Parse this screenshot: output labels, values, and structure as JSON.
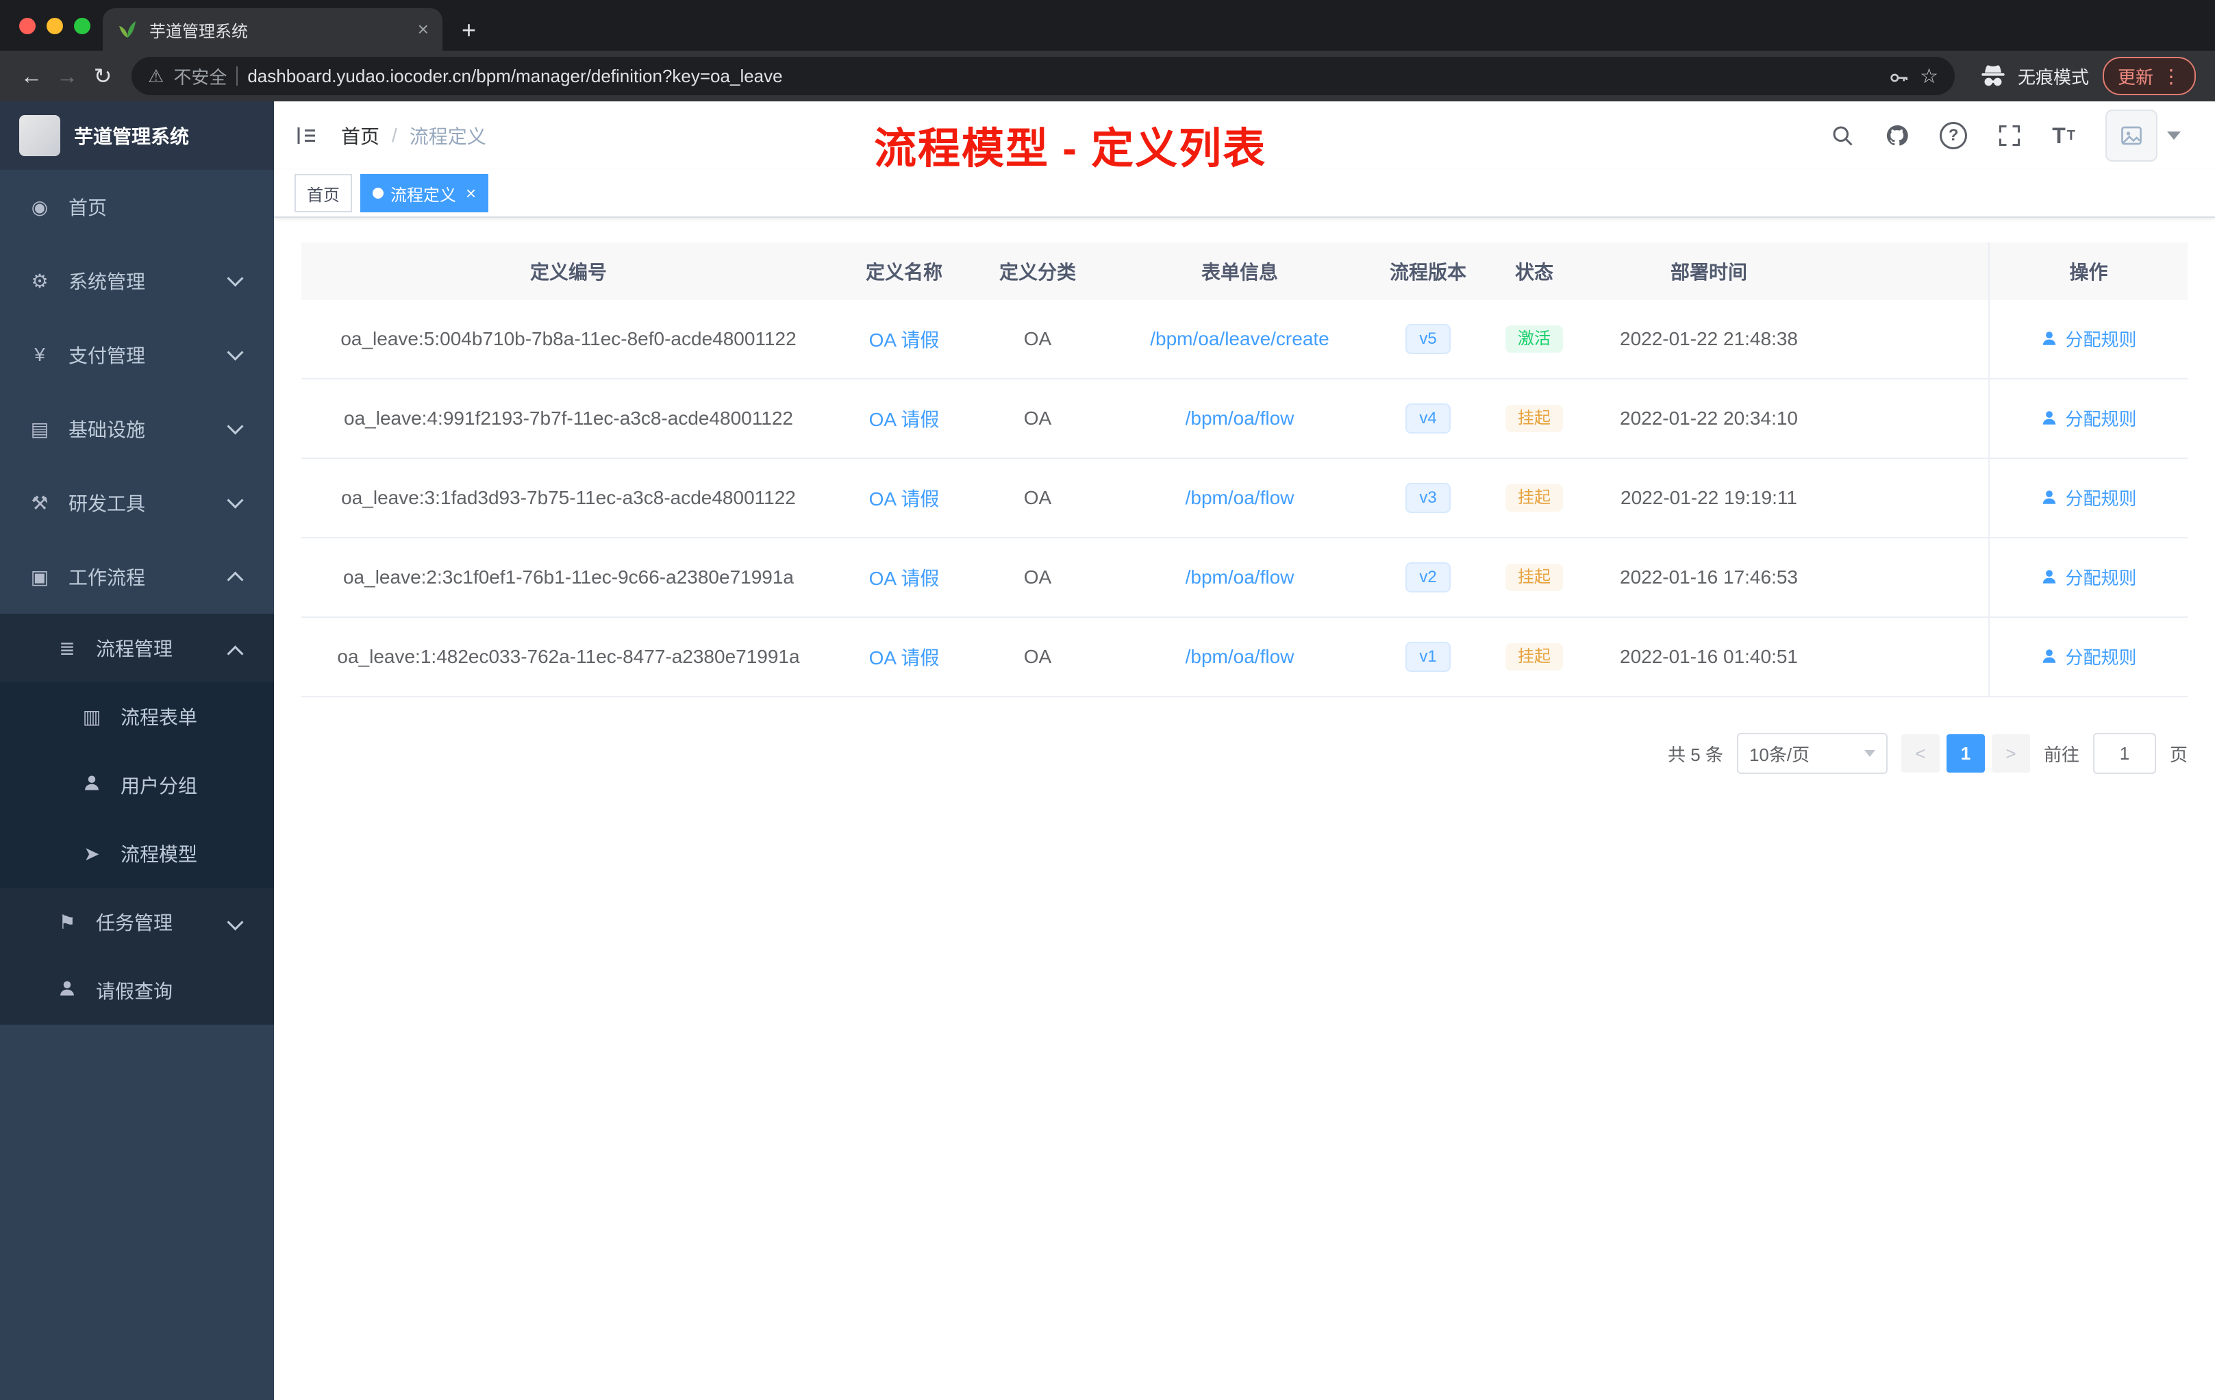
{
  "browser": {
    "tab_title": "芋道管理系统",
    "security_label": "不安全",
    "url": "dashboard.yudao.iocoder.cn/bpm/manager/definition?key=oa_leave",
    "incognito_label": "无痕模式",
    "update_label": "更新"
  },
  "sidebar": {
    "logo_title": "芋道管理系统",
    "items": [
      {
        "label": "首页"
      },
      {
        "label": "系统管理"
      },
      {
        "label": "支付管理"
      },
      {
        "label": "基础设施"
      },
      {
        "label": "研发工具"
      },
      {
        "label": "工作流程"
      },
      {
        "label": "流程管理"
      },
      {
        "label": "流程表单"
      },
      {
        "label": "用户分组"
      },
      {
        "label": "流程模型"
      },
      {
        "label": "任务管理"
      },
      {
        "label": "请假查询"
      }
    ]
  },
  "header": {
    "breadcrumb_home": "首页",
    "breadcrumb_current": "流程定义",
    "annotation": "流程模型 - 定义列表"
  },
  "tags": {
    "home": "首页",
    "active": "流程定义"
  },
  "table": {
    "columns": [
      "定义编号",
      "定义名称",
      "定义分类",
      "表单信息",
      "流程版本",
      "状态",
      "部署时间",
      "操作"
    ],
    "rows": [
      {
        "id": "oa_leave:5:004b710b-7b8a-11ec-8ef0-acde48001122",
        "name": "OA 请假",
        "category": "OA",
        "form": "/bpm/oa/leave/create",
        "version": "v5",
        "status": "激活",
        "time": "2022-01-22 21:48:38",
        "action": "分配规则"
      },
      {
        "id": "oa_leave:4:991f2193-7b7f-11ec-a3c8-acde48001122",
        "name": "OA 请假",
        "category": "OA",
        "form": "/bpm/oa/flow",
        "version": "v4",
        "status": "挂起",
        "time": "2022-01-22 20:34:10",
        "action": "分配规则"
      },
      {
        "id": "oa_leave:3:1fad3d93-7b75-11ec-a3c8-acde48001122",
        "name": "OA 请假",
        "category": "OA",
        "form": "/bpm/oa/flow",
        "version": "v3",
        "status": "挂起",
        "time": "2022-01-22 19:19:11",
        "action": "分配规则"
      },
      {
        "id": "oa_leave:2:3c1f0ef1-76b1-11ec-9c66-a2380e71991a",
        "name": "OA 请假",
        "category": "OA",
        "form": "/bpm/oa/flow",
        "version": "v2",
        "status": "挂起",
        "time": "2022-01-16 17:46:53",
        "action": "分配规则"
      },
      {
        "id": "oa_leave:1:482ec033-762a-11ec-8477-a2380e71991a",
        "name": "OA 请假",
        "category": "OA",
        "form": "/bpm/oa/flow",
        "version": "v1",
        "status": "挂起",
        "time": "2022-01-16 01:40:51",
        "action": "分配规则"
      }
    ]
  },
  "pagination": {
    "total": "共 5 条",
    "page_size": "10条/页",
    "current_page": "1",
    "goto_label": "前往",
    "goto_value": "1",
    "page_unit": "页"
  },
  "colors": {
    "accent": "#409eff",
    "annotation_red": "#f21c0d",
    "status_active_text": "#13ce66",
    "status_suspend_text": "#e6a23c",
    "sidebar_bg": "#304156",
    "submenu_bg": "#1f2d3d"
  }
}
